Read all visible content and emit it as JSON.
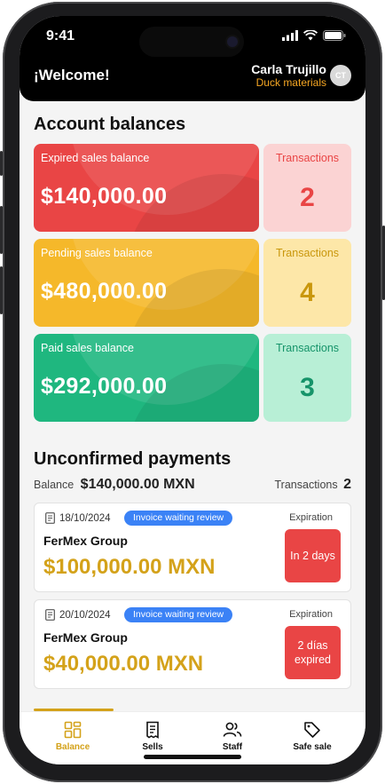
{
  "status_bar": {
    "time": "9:41"
  },
  "header": {
    "welcome": "¡Welcome!",
    "user_name": "Carla Trujillo",
    "user_org": "Duck materials",
    "avatar_initials": "CT"
  },
  "balances": {
    "title": "Account balances",
    "items": [
      {
        "label": "Expired sales balance",
        "amount": "$140,000.00",
        "tx_label": "Transactions",
        "tx_count": "2",
        "color": "#e94545",
        "tx_bg": "#fbd3d3",
        "tx_color": "#e94545"
      },
      {
        "label": "Pending sales balance",
        "amount": "$480,000.00",
        "tx_label": "Transactions",
        "tx_count": "4",
        "color": "#f5b82a",
        "tx_bg": "#fde7a8",
        "tx_color": "#c9970c"
      },
      {
        "label": "Paid sales balance",
        "amount": "$292,000.00",
        "tx_label": "Transactions",
        "tx_count": "3",
        "color": "#1fb77f",
        "tx_bg": "#b8efd6",
        "tx_color": "#16946a"
      }
    ]
  },
  "unconfirmed": {
    "title": "Unconfirmed payments",
    "balance_label": "Balance",
    "balance_value": "$140,000.00 MXN",
    "tx_label": "Transactions",
    "tx_value": "2",
    "payments": [
      {
        "date": "18/10/2024",
        "status": "Invoice waiting review",
        "company": "FerMex Group",
        "amount": "$100,000.00 MXN",
        "exp_label": "Expiration",
        "exp_value_line1": "In 2 days",
        "exp_value_line2": ""
      },
      {
        "date": "20/10/2024",
        "status": "Invoice waiting review",
        "company": "FerMex Group",
        "amount": "$40,000.00 MXN",
        "exp_label": "Expiration",
        "exp_value_line1": "2 días",
        "exp_value_line2": "expired"
      }
    ]
  },
  "tabs": [
    {
      "label": "Balance",
      "icon": "dashboard-icon",
      "active": true
    },
    {
      "label": "Sells",
      "icon": "receipt-icon",
      "active": false
    },
    {
      "label": "Staff",
      "icon": "users-icon",
      "active": false
    },
    {
      "label": "Safe sale",
      "icon": "tag-icon",
      "active": false
    }
  ],
  "colors": {
    "accent": "#d4a21a",
    "badge": "#3b82f6",
    "danger": "#e94545"
  }
}
